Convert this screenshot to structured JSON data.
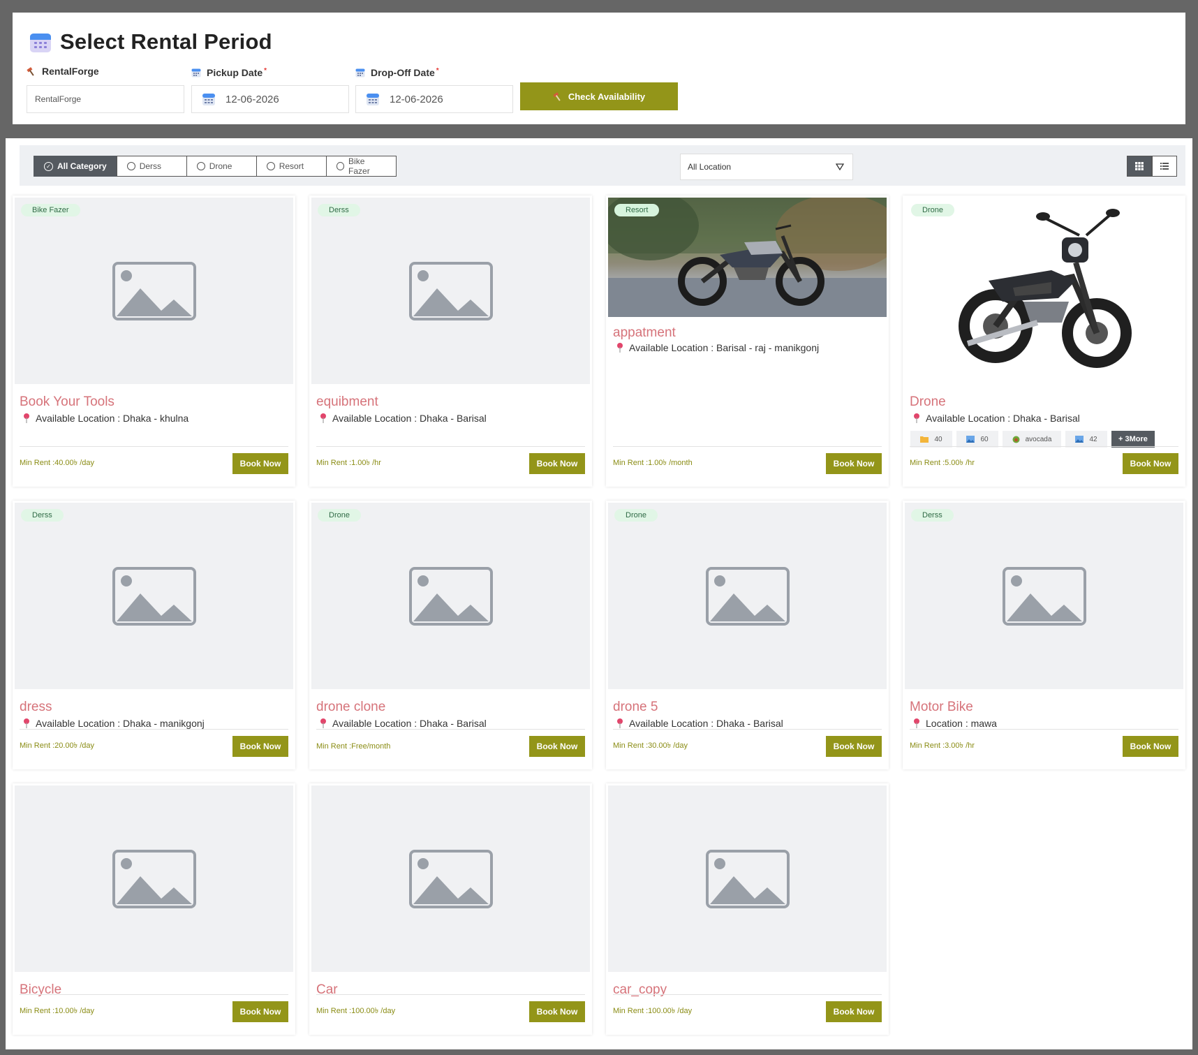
{
  "top": {
    "title": "Select Rental Period",
    "store_label": "RentalForge",
    "store_value": "RentalForge",
    "pickup_label": "Pickup Date",
    "pickup_value": "12-06-2026",
    "dropoff_label": "Drop-Off Date",
    "dropoff_value": "12-06-2026",
    "required_mark": "*",
    "check_button": "Check Availability"
  },
  "filters": {
    "categories": [
      "All Category",
      "Derss",
      "Drone",
      "Resort",
      "Bike Fazer"
    ],
    "location": "All Location"
  },
  "colors": {
    "accent": "#939519",
    "title": "#d6737a",
    "dark": "#555a60",
    "badge_bg": "#e1f6e6"
  },
  "book_label": "Book Now",
  "cards": [
    {
      "badge": "Bike Fazer",
      "title": "Book Your Tools",
      "location": "Available Location : Dhaka - khulna",
      "rent": "Min Rent :40.00৳ /day"
    },
    {
      "badge": "Derss",
      "title": "equibment",
      "location": "Available Location : Dhaka - Barisal",
      "rent": "Min Rent :1.00৳ /hr"
    },
    {
      "badge": "Resort",
      "title": "appatment",
      "location": "Available Location : Barisal - raj - manikgonj",
      "rent": "Min Rent :1.00৳ /month"
    },
    {
      "badge": "Drone",
      "title": "Drone",
      "location": "Available Location : Dhaka - Barisal",
      "rent": "Min Rent :5.00৳ /hr",
      "features": [
        {
          "icon": "folder-icon",
          "label": "40"
        },
        {
          "icon": "image-icon",
          "label": "60"
        },
        {
          "icon": "fruit-icon",
          "label": "avocada"
        },
        {
          "icon": "image-icon",
          "label": "42"
        }
      ],
      "more": "+ 3More"
    },
    {
      "badge": "Derss",
      "title": "dress",
      "location": "Available Location : Dhaka - manikgonj",
      "rent": "Min Rent :20.00৳ /day"
    },
    {
      "badge": "Drone",
      "title": "drone clone",
      "location": "Available Location : Dhaka - Barisal",
      "rent": "Min Rent :Free/month"
    },
    {
      "badge": "Drone",
      "title": "drone 5",
      "location": "Available Location : Dhaka - Barisal",
      "rent": "Min Rent :30.00৳ /day"
    },
    {
      "badge": "Derss",
      "title": "Motor Bike",
      "location": "Location : mawa",
      "rent": "Min Rent :3.00৳ /hr"
    },
    {
      "title": "Bicycle",
      "rent": "Min Rent :10.00৳ /day"
    },
    {
      "title": "Car",
      "rent": "Min Rent :100.00৳ /day"
    },
    {
      "title": "car_copy",
      "rent": "Min Rent :100.00৳ /day"
    }
  ]
}
